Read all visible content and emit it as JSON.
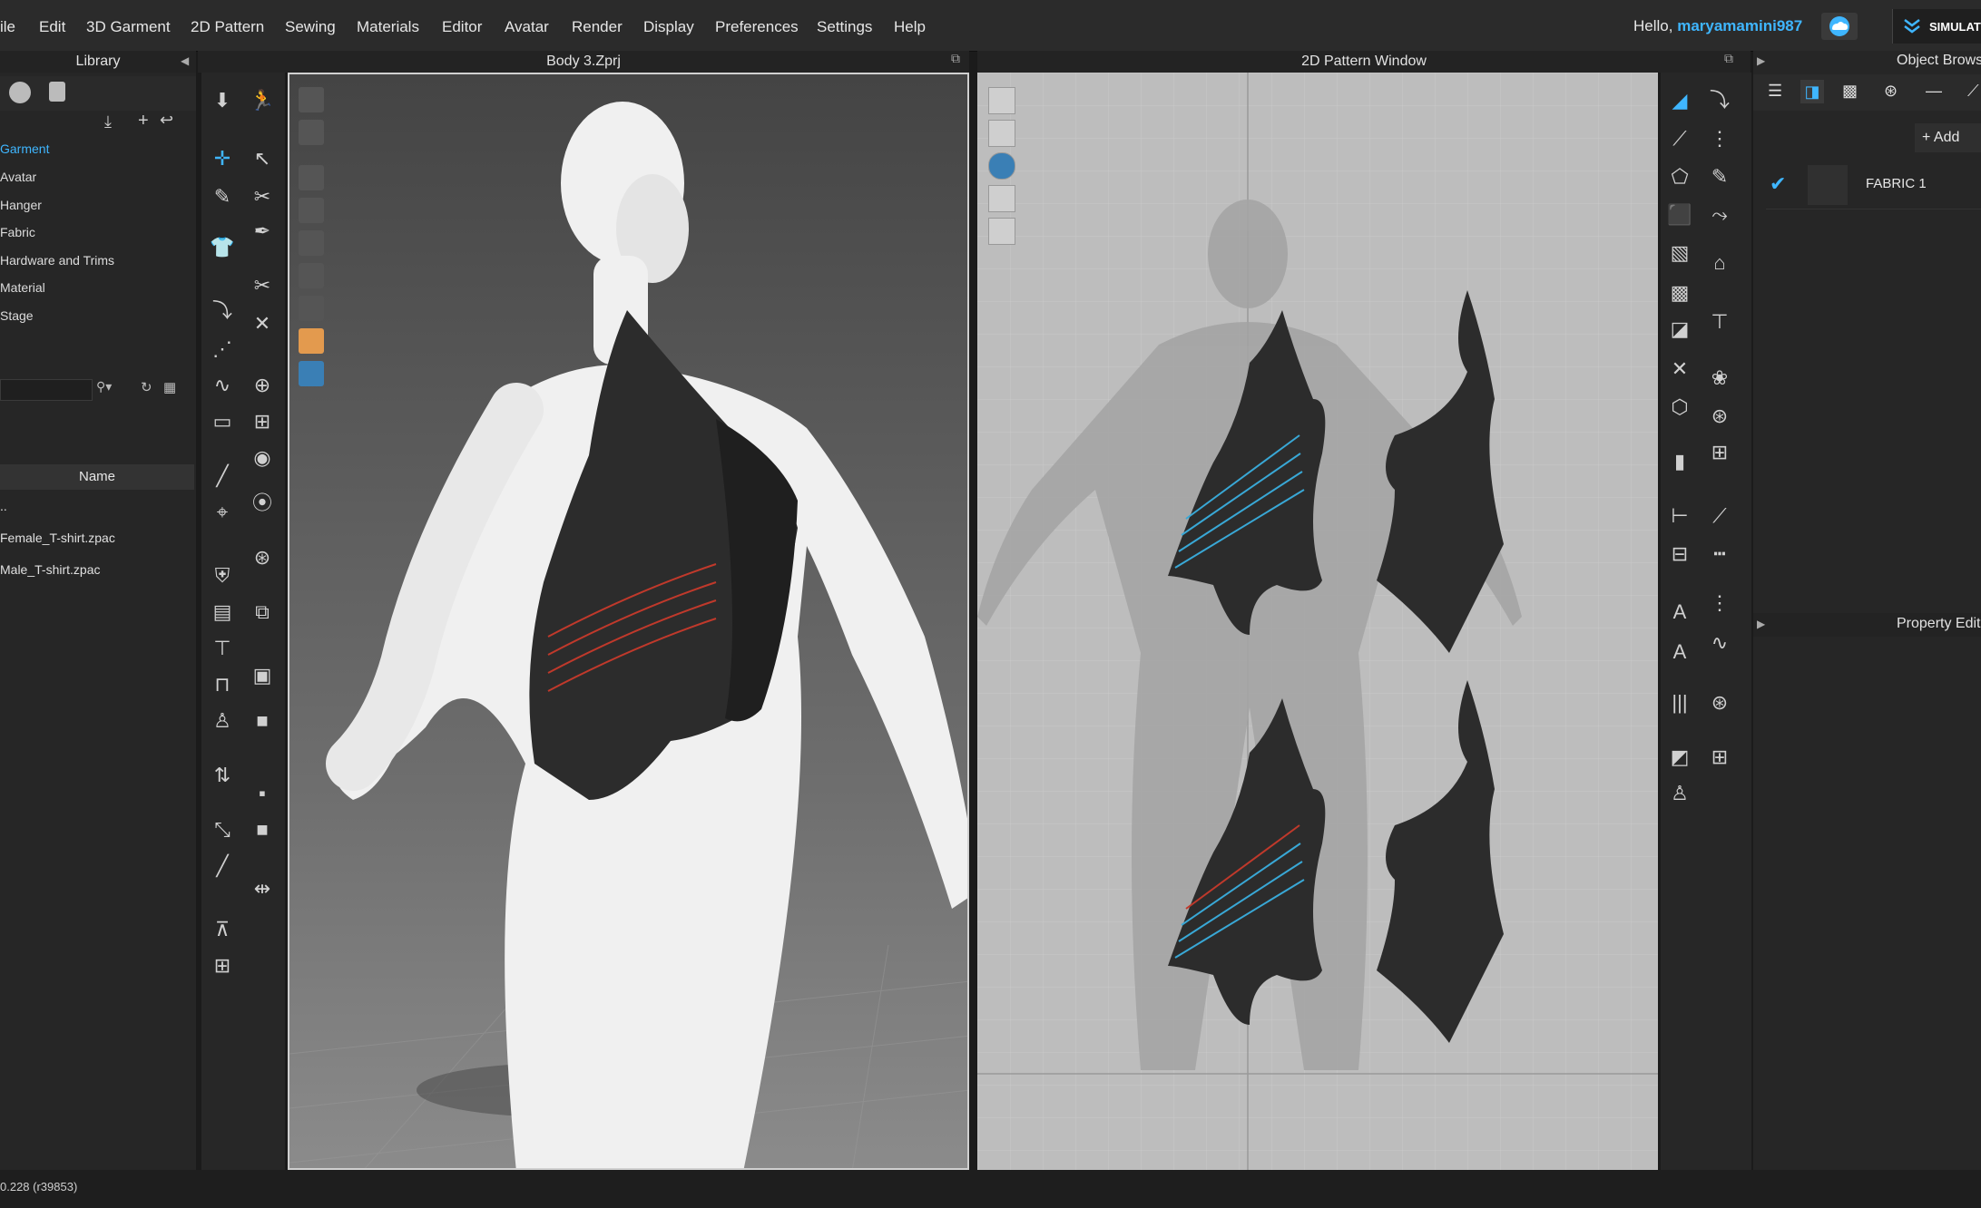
{
  "menu": {
    "items": [
      "ile",
      "Edit",
      "3D Garment",
      "2D Pattern",
      "Sewing",
      "Materials",
      "Editor",
      "Avatar",
      "Render",
      "Display",
      "Preferences",
      "Settings",
      "Help"
    ]
  },
  "user": {
    "greeting": "Hello,",
    "name": "maryamamini987"
  },
  "simulation": {
    "label": "SIMULATI"
  },
  "library": {
    "title": "Library",
    "categories": [
      "Garment",
      "Avatar",
      "Hanger",
      "Fabric",
      "Hardware and Trims",
      "Material",
      "Stage"
    ],
    "active_category": "Garment",
    "table_header": "Name",
    "files": [
      "..",
      "Female_T-shirt.zpac",
      "Male_T-shirt.zpac"
    ]
  },
  "viewport3d": {
    "title": "Body 3.Zprj"
  },
  "viewport2d": {
    "title": "2D Pattern Window"
  },
  "object_browser": {
    "title": "Object Brows",
    "add_label": "+ Add",
    "fabric_name": "FABRIC 1"
  },
  "property_editor": {
    "title": "Property Edit"
  },
  "status": {
    "text": "0.228 (r39853)"
  },
  "colors": {
    "accent": "#3fb6ff",
    "garment": "#2c2c2c",
    "stitch_red": "#c0392b",
    "stitch_blue": "#39a8d6"
  },
  "icons": {
    "cloud": "cloud-icon",
    "check": "check-icon",
    "list": "list-icon"
  }
}
